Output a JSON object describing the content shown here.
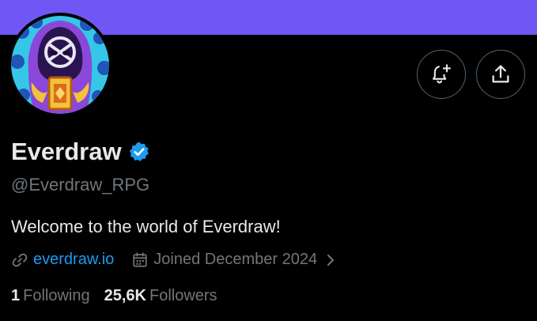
{
  "profile": {
    "name": "Everdraw",
    "handle": "@Everdraw_RPG",
    "bio": "Welcome to the world of Everdraw!",
    "website": "everdraw.io",
    "joined": "Joined December 2024"
  },
  "stats": {
    "following_count": "1",
    "following_label": "Following",
    "followers_count": "25,6K",
    "followers_label": "Followers"
  },
  "icons": {
    "verified": "verified-badge-icon",
    "notify": "bell-plus-icon",
    "share": "share-icon",
    "link": "link-icon",
    "calendar": "calendar-icon",
    "chevron": "chevron-right-icon"
  },
  "colors": {
    "banner": "#7057f5",
    "link": "#1d9bf0",
    "verified": "#1d9bf0",
    "muted": "#71767b"
  }
}
